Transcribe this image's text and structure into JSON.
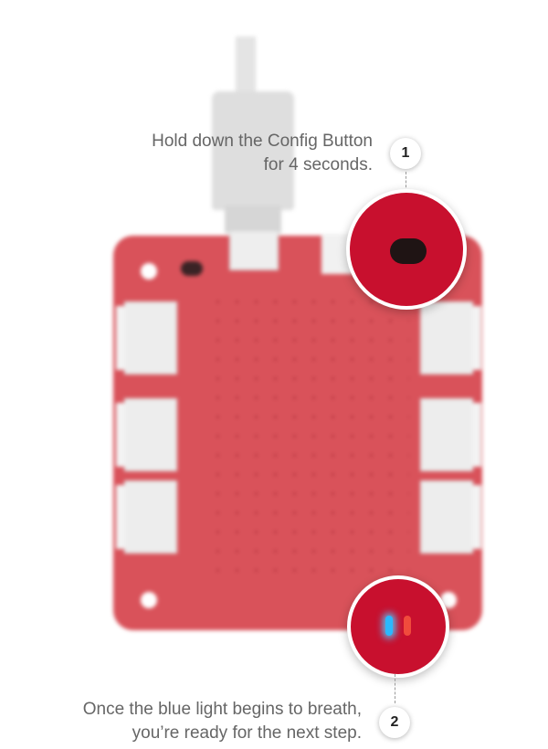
{
  "step1": {
    "number": "1",
    "line1": "Hold down the Config Button",
    "line2": "for 4 seconds."
  },
  "step2": {
    "number": "2",
    "line1": "Once the blue light begins to breath,",
    "line2": "you’re ready for the next step."
  },
  "colors": {
    "board": "#d9525a",
    "callout": "#c8102e",
    "led_blue": "#2ab8ff",
    "led_red": "#f04b3c",
    "caption_text": "#666666"
  },
  "icons": [
    "usb-cable-icon",
    "config-button-icon",
    "led-indicator-icon"
  ]
}
